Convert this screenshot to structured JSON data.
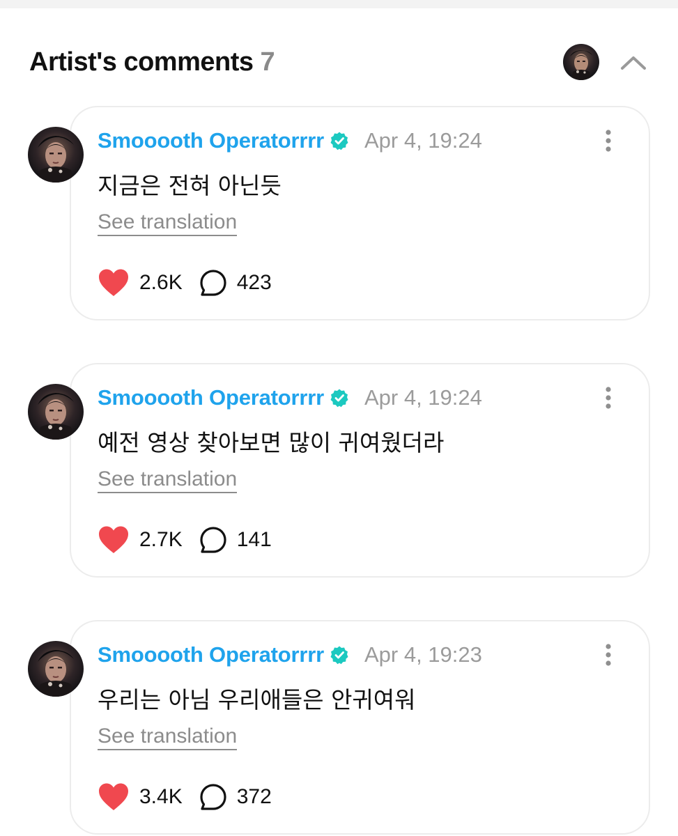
{
  "header": {
    "title": "Artist's comments",
    "count": "7"
  },
  "colors": {
    "author": "#1fa3ec",
    "verified": "#1cc9c0",
    "like": "#f0484f",
    "muted": "#9b9b9b"
  },
  "comments": [
    {
      "author": "Smooooth Operatorrrr",
      "timestamp": "Apr 4, 19:24",
      "text": "지금은 전혀 아닌듯",
      "see_translation": "See translation",
      "likes": "2.6K",
      "replies": "423"
    },
    {
      "author": "Smooooth Operatorrrr",
      "timestamp": "Apr 4, 19:24",
      "text": "예전 영상 찾아보면 많이 귀여웠더라",
      "see_translation": "See translation",
      "likes": "2.7K",
      "replies": "141"
    },
    {
      "author": "Smooooth Operatorrrr",
      "timestamp": "Apr 4, 19:23",
      "text": "우리는 아님 우리애들은 안귀여워",
      "see_translation": "See translation",
      "likes": "3.4K",
      "replies": "372"
    }
  ]
}
